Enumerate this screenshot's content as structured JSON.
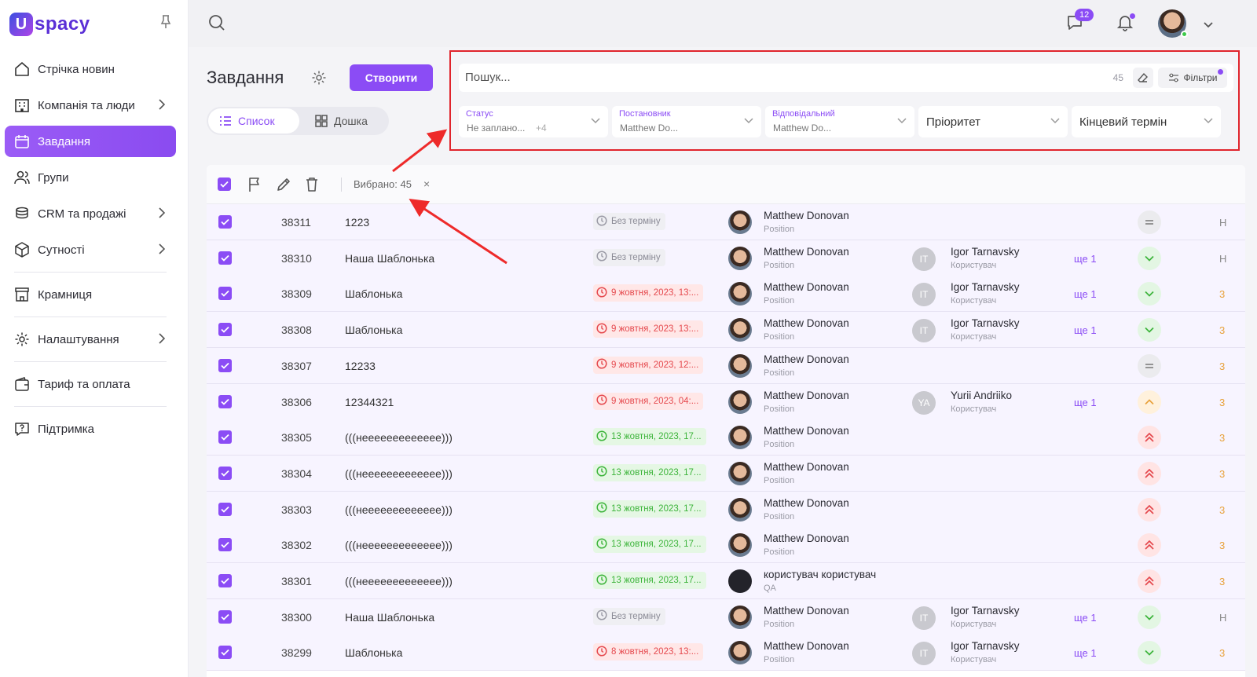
{
  "app": {
    "logo_mark": "U",
    "logo_text": "spacy"
  },
  "sidebar": {
    "items": [
      {
        "label": "Стрічка новин",
        "icon": "home-icon",
        "expandable": false,
        "active": false
      },
      {
        "label": "Компанія та люди",
        "icon": "building-icon",
        "expandable": true,
        "active": false
      },
      {
        "label": "Завдання",
        "icon": "calendar-icon",
        "expandable": false,
        "active": true
      },
      {
        "label": "Групи",
        "icon": "users-icon",
        "expandable": false,
        "active": false
      },
      {
        "label": "CRM та продажі",
        "icon": "coins-icon",
        "expandable": true,
        "active": false
      },
      {
        "label": "Сутності",
        "icon": "cube-icon",
        "expandable": true,
        "active": false
      },
      {
        "label": "Крамниця",
        "icon": "store-icon",
        "expandable": false,
        "active": false
      },
      {
        "label": "Налаштування",
        "icon": "gear-icon",
        "expandable": true,
        "active": false
      },
      {
        "label": "Тариф та оплата",
        "icon": "wallet-icon",
        "expandable": false,
        "active": false
      },
      {
        "label": "Підтримка",
        "icon": "help-icon",
        "expandable": false,
        "active": false
      }
    ]
  },
  "topbar": {
    "chat_count": "12"
  },
  "header": {
    "title": "Завдання",
    "create_label": "Створити",
    "views": {
      "list": "Список",
      "board": "Дошка"
    }
  },
  "filters": {
    "search_placeholder": "Пошук...",
    "count": "45",
    "filters_label": "Фільтри",
    "status": {
      "label": "Статус",
      "value": "Не заплано...",
      "more": "+4"
    },
    "creator": {
      "label": "Постановник",
      "value": "Matthew Do..."
    },
    "responsible": {
      "label": "Відповідальний",
      "value": "Matthew Do..."
    },
    "priority": {
      "placeholder": "Пріоритет"
    },
    "deadline": {
      "placeholder": "Кінцевий термін"
    }
  },
  "toolbar": {
    "selected_label": "Вибрано: 45",
    "close_glyph": "×"
  },
  "colors": {
    "accent": "#8b4cf5",
    "highlight_border": "#e0242c",
    "arrow": "#ee2a2a"
  },
  "rows": [
    {
      "id": "38311",
      "name": "1223",
      "deadline": "Без терміну",
      "deadline_type": "none",
      "creator": "Matthew Donovan",
      "creator_pos": "Position",
      "resp_initials": "",
      "resp_name": "",
      "resp_role": "",
      "more": "",
      "priority": "eq",
      "edge": "Н"
    },
    {
      "id": "38310",
      "name": "Наша Шаблонька",
      "deadline": "Без терміну",
      "deadline_type": "none",
      "creator": "Matthew Donovan",
      "creator_pos": "Position",
      "resp_initials": "IT",
      "resp_name": "Igor Tarnavsky",
      "resp_role": "Користувач",
      "more": "ще 1",
      "priority": "low",
      "edge": "Н"
    },
    {
      "id": "38309",
      "name": "Шаблонька",
      "deadline": "9 жовтня, 2023, 13:...",
      "deadline_type": "over",
      "creator": "Matthew Donovan",
      "creator_pos": "Position",
      "resp_initials": "IT",
      "resp_name": "Igor Tarnavsky",
      "resp_role": "Користувач",
      "more": "ще 1",
      "priority": "low",
      "edge": "3"
    },
    {
      "id": "38308",
      "name": "Шаблонька",
      "deadline": "9 жовтня, 2023, 13:...",
      "deadline_type": "over",
      "creator": "Matthew Donovan",
      "creator_pos": "Position",
      "resp_initials": "IT",
      "resp_name": "Igor Tarnavsky",
      "resp_role": "Користувач",
      "more": "ще 1",
      "priority": "low",
      "edge": "3"
    },
    {
      "id": "38307",
      "name": "12233",
      "deadline": "9 жовтня, 2023, 12:...",
      "deadline_type": "over",
      "creator": "Matthew Donovan",
      "creator_pos": "Position",
      "resp_initials": "",
      "resp_name": "",
      "resp_role": "",
      "more": "",
      "priority": "eq",
      "edge": "3"
    },
    {
      "id": "38306",
      "name": "12344321",
      "deadline": "9 жовтня, 2023, 04:...",
      "deadline_type": "over",
      "creator": "Matthew Donovan",
      "creator_pos": "Position",
      "resp_initials": "YA",
      "resp_name": "Yurii Andriiko",
      "resp_role": "Користувач",
      "more": "ще 1",
      "priority": "med",
      "edge": "3"
    },
    {
      "id": "38305",
      "name": "(((неееееееееееее)))",
      "deadline": "13 жовтня, 2023, 17...",
      "deadline_type": "ok",
      "creator": "Matthew Donovan",
      "creator_pos": "Position",
      "resp_initials": "",
      "resp_name": "",
      "resp_role": "",
      "more": "",
      "priority": "high",
      "edge": "3"
    },
    {
      "id": "38304",
      "name": "(((неееееееееееее)))",
      "deadline": "13 жовтня, 2023, 17...",
      "deadline_type": "ok",
      "creator": "Matthew Donovan",
      "creator_pos": "Position",
      "resp_initials": "",
      "resp_name": "",
      "resp_role": "",
      "more": "",
      "priority": "high",
      "edge": "3"
    },
    {
      "id": "38303",
      "name": "(((неееееееееееее)))",
      "deadline": "13 жовтня, 2023, 17...",
      "deadline_type": "ok",
      "creator": "Matthew Donovan",
      "creator_pos": "Position",
      "resp_initials": "",
      "resp_name": "",
      "resp_role": "",
      "more": "",
      "priority": "high",
      "edge": "3"
    },
    {
      "id": "38302",
      "name": "(((неееееееееееее)))",
      "deadline": "13 жовтня, 2023, 17...",
      "deadline_type": "ok",
      "creator": "Matthew Donovan",
      "creator_pos": "Position",
      "resp_initials": "",
      "resp_name": "",
      "resp_role": "",
      "more": "",
      "priority": "high",
      "edge": "3"
    },
    {
      "id": "38301",
      "name": "(((неееееееееееее)))",
      "deadline": "13 жовтня, 2023, 17...",
      "deadline_type": "ok",
      "creator": "користувач користувач",
      "creator_pos": "QA",
      "resp_initials": "",
      "resp_name": "",
      "resp_role": "",
      "more": "",
      "priority": "high",
      "edge": "3",
      "dark_avatar": true
    },
    {
      "id": "38300",
      "name": "Наша Шаблонька",
      "deadline": "Без терміну",
      "deadline_type": "none",
      "creator": "Matthew Donovan",
      "creator_pos": "Position",
      "resp_initials": "IT",
      "resp_name": "Igor Tarnavsky",
      "resp_role": "Користувач",
      "more": "ще 1",
      "priority": "low",
      "edge": "Н"
    },
    {
      "id": "38299",
      "name": "Шаблонька",
      "deadline": "8 жовтня, 2023, 13:...",
      "deadline_type": "over",
      "creator": "Matthew Donovan",
      "creator_pos": "Position",
      "resp_initials": "IT",
      "resp_name": "Igor Tarnavsky",
      "resp_role": "Користувач",
      "more": "ще 1",
      "priority": "low",
      "edge": "3"
    }
  ]
}
